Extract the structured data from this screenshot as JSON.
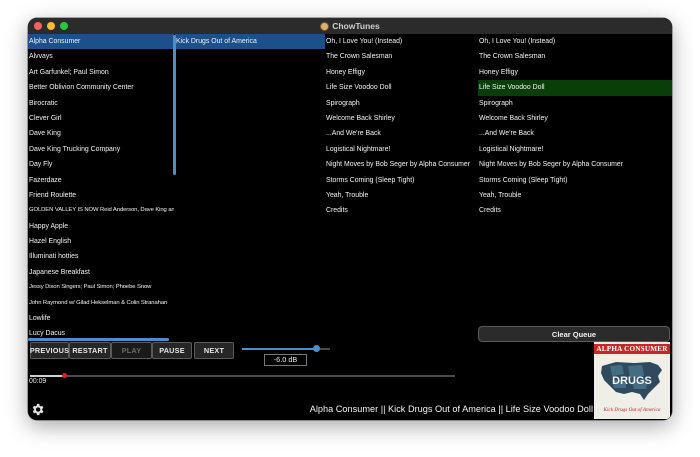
{
  "window": {
    "title": "ChowTunes"
  },
  "artists": [
    "Alpha Consumer",
    "Alvvays",
    "Art Garfunkel; Paul Simon",
    "Better Oblivion Community Center",
    "Birocratic",
    "Clever Girl",
    "Dave King",
    "Dave King Trucking Company",
    "Day Fly",
    "Fazerdaze",
    "Friend Roulette",
    "GOLDEN VALLEY IS NOW Reid Anderson, Dave King and Craig Taborn",
    "Happy Apple",
    "Hazel English",
    "Illuminati hotties",
    "Japanese Breakfast",
    "Jessy Dixon Singers; Paul Simon; Phoebe Snow",
    "John Raymond w/ Gilad Hekselman & Colin Stranahan",
    "Lowlife",
    "Lucy Dacus"
  ],
  "albums": [
    "Kick Drugs Out of America"
  ],
  "tracks": [
    "Oh, I Love You! (Instead)",
    "The Crown Salesman",
    "Honey Effigy",
    "Life Size Voodoo Doll",
    "Spirograph",
    "Welcome Back Shirley",
    "...And We're Back",
    "Logistical Nightmare!",
    "Night Moves by Bob Seger by Alpha Consumer",
    "Storms Coming (Sleep Tight)",
    "Yeah, Trouble",
    "Credits"
  ],
  "queue": [
    "Oh, I Love You! (Instead)",
    "The Crown Salesman",
    "Honey Effigy",
    "Life Size Voodoo Doll",
    "Spirograph",
    "Welcome Back Shirley",
    "...And We're Back",
    "Logistical Nightmare!",
    "Night Moves by Bob Seger by Alpha Consumer",
    "Storms Coming (Sleep Tight)",
    "Yeah, Trouble",
    "Credits"
  ],
  "selection": {
    "artist_index": 0,
    "album_index": 0,
    "queue_playing_index": 3
  },
  "controls": {
    "previous": "PREVIOUS",
    "restart": "RESTART",
    "play": "PLAY",
    "pause": "PAUSE",
    "next": "NEXT",
    "clear_queue": "Clear Queue"
  },
  "volume": {
    "level": 0.85,
    "gain_label": "-6.0 dB"
  },
  "progress": {
    "fraction": 0.08,
    "elapsed": "00:09"
  },
  "now_playing": "Alpha Consumer || Kick Drugs Out of America || Life Size Voodoo Doll",
  "album_art": {
    "band": "ALPHA CONSUMER",
    "caption": "Kick Drugs Out of America",
    "word": "DRUGS"
  },
  "colors": {
    "selection": "#1d4f8a",
    "playing": "#093d09",
    "accent": "#4a8fcc",
    "playhead": "#e02020"
  },
  "icons": {
    "settings": "gear-icon",
    "app": "chowtunes-app-icon"
  }
}
